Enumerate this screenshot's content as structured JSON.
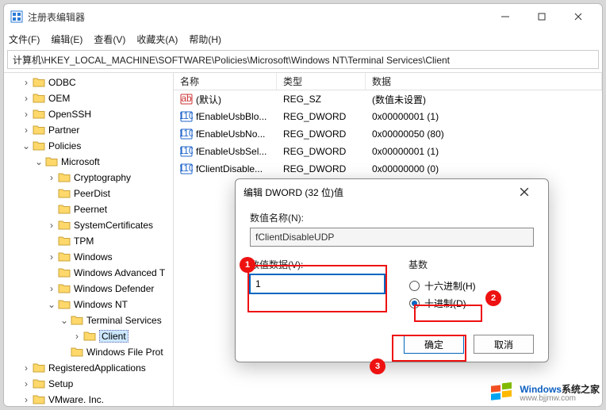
{
  "window": {
    "title": "注册表编辑器",
    "menu": {
      "file": "文件(F)",
      "edit": "编辑(E)",
      "view": "查看(V)",
      "favorites": "收藏夹(A)",
      "help": "帮助(H)"
    },
    "path": "计算机\\HKEY_LOCAL_MACHINE\\SOFTWARE\\Policies\\Microsoft\\Windows NT\\Terminal Services\\Client"
  },
  "tree": [
    {
      "lvl": 1,
      "tw": ">",
      "label": "ODBC"
    },
    {
      "lvl": 1,
      "tw": ">",
      "label": "OEM"
    },
    {
      "lvl": 1,
      "tw": ">",
      "label": "OpenSSH"
    },
    {
      "lvl": 1,
      "tw": ">",
      "label": "Partner"
    },
    {
      "lvl": 1,
      "tw": "v",
      "label": "Policies"
    },
    {
      "lvl": 2,
      "tw": "v",
      "label": "Microsoft"
    },
    {
      "lvl": 3,
      "tw": ">",
      "label": "Cryptography"
    },
    {
      "lvl": 3,
      "tw": "",
      "label": "PeerDist"
    },
    {
      "lvl": 3,
      "tw": "",
      "label": "Peernet"
    },
    {
      "lvl": 3,
      "tw": ">",
      "label": "SystemCertificates"
    },
    {
      "lvl": 3,
      "tw": "",
      "label": "TPM"
    },
    {
      "lvl": 3,
      "tw": ">",
      "label": "Windows"
    },
    {
      "lvl": 3,
      "tw": "",
      "label": "Windows Advanced T"
    },
    {
      "lvl": 3,
      "tw": ">",
      "label": "Windows Defender"
    },
    {
      "lvl": 3,
      "tw": "v",
      "label": "Windows NT"
    },
    {
      "lvl": 4,
      "tw": "v",
      "label": "Terminal Services"
    },
    {
      "lvl": 5,
      "tw": ">",
      "label": "Client",
      "sel": true
    },
    {
      "lvl": 4,
      "tw": "",
      "label": "Windows File Prot"
    },
    {
      "lvl": 1,
      "tw": ">",
      "label": "RegisteredApplications"
    },
    {
      "lvl": 1,
      "tw": ">",
      "label": "Setup"
    },
    {
      "lvl": 1,
      "tw": ">",
      "label": "VMware. Inc."
    }
  ],
  "columns": {
    "name": "名称",
    "type": "类型",
    "data": "数据"
  },
  "rows": [
    {
      "icon": "str",
      "name": "(默认)",
      "type": "REG_SZ",
      "data": "(数值未设置)"
    },
    {
      "icon": "num",
      "name": "fEnableUsbBlo...",
      "type": "REG_DWORD",
      "data": "0x00000001 (1)"
    },
    {
      "icon": "num",
      "name": "fEnableUsbNo...",
      "type": "REG_DWORD",
      "data": "0x00000050 (80)"
    },
    {
      "icon": "num",
      "name": "fEnableUsbSel...",
      "type": "REG_DWORD",
      "data": "0x00000001 (1)"
    },
    {
      "icon": "num",
      "name": "fClientDisable...",
      "type": "REG_DWORD",
      "data": "0x00000000 (0)"
    }
  ],
  "dialog": {
    "title": "编辑 DWORD (32 位)值",
    "name_label": "数值名称(N):",
    "name_value": "fClientDisableUDP",
    "data_label": "数值数据(V):",
    "data_value": "1",
    "base_label": "基数",
    "hex_label": "十六进制(H)",
    "dec_label": "十进制(D)",
    "ok": "确定",
    "cancel": "取消"
  },
  "annotations": {
    "n1": "1",
    "n2": "2",
    "n3": "3"
  },
  "watermark": {
    "brand": "Windows",
    "cn": "系统之家",
    "url": "www.bjjmw.com"
  }
}
